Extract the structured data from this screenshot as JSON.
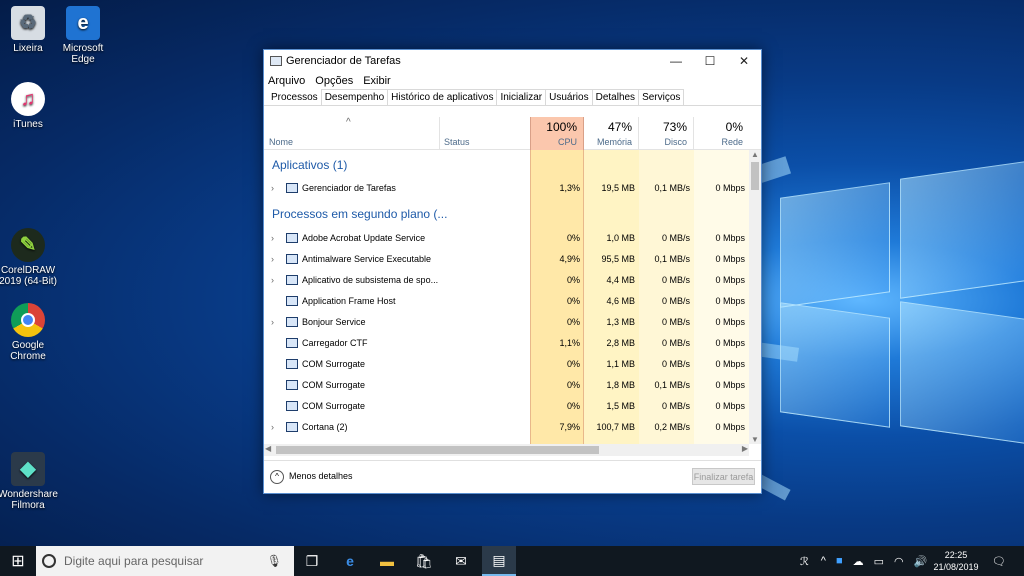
{
  "desktop": {
    "icons": [
      {
        "name": "recycle-bin",
        "label1": "Lixeira",
        "label2": ""
      },
      {
        "name": "edge",
        "label1": "Microsoft",
        "label2": "Edge"
      },
      {
        "name": "itunes",
        "label1": "iTunes",
        "label2": ""
      },
      {
        "name": "coreldraw",
        "label1": "CorelDRAW",
        "label2": "2019 (64-Bit)"
      },
      {
        "name": "chrome",
        "label1": "Google",
        "label2": "Chrome"
      },
      {
        "name": "filmora",
        "label1": "Wondershare",
        "label2": "Filmora"
      }
    ]
  },
  "window": {
    "title": "Gerenciador de Tarefas",
    "menu": [
      "Arquivo",
      "Opções",
      "Exibir"
    ],
    "tabs": [
      "Processos",
      "Desempenho",
      "Histórico de aplicativos",
      "Inicializar",
      "Usuários",
      "Detalhes",
      "Serviços"
    ],
    "columns": {
      "name": "Nome",
      "status": "Status",
      "cpu_pct": "100%",
      "cpu": "CPU",
      "mem_pct": "47%",
      "mem": "Memória",
      "disk_pct": "73%",
      "disk": "Disco",
      "net_pct": "0%",
      "net": "Rede"
    },
    "sections": {
      "apps": "Aplicativos (1)",
      "background": "Processos em segundo plano (..."
    },
    "processes": [
      {
        "name": "Gerenciador de Tarefas",
        "expand": true,
        "cpu": "1,3%",
        "mem": "19,5 MB",
        "disk": "0,1 MB/s",
        "net": "0 Mbps"
      },
      {
        "name": "Adobe Acrobat Update Service",
        "expand": true,
        "cpu": "0%",
        "mem": "1,0 MB",
        "disk": "0 MB/s",
        "net": "0 Mbps"
      },
      {
        "name": "Antimalware Service Executable",
        "expand": true,
        "cpu": "4,9%",
        "mem": "95,5 MB",
        "disk": "0,1 MB/s",
        "net": "0 Mbps"
      },
      {
        "name": "Aplicativo de subsistema de spo...",
        "expand": true,
        "cpu": "0%",
        "mem": "4,4 MB",
        "disk": "0 MB/s",
        "net": "0 Mbps"
      },
      {
        "name": "Application Frame Host",
        "expand": false,
        "cpu": "0%",
        "mem": "4,6 MB",
        "disk": "0 MB/s",
        "net": "0 Mbps"
      },
      {
        "name": "Bonjour Service",
        "expand": true,
        "cpu": "0%",
        "mem": "1,3 MB",
        "disk": "0 MB/s",
        "net": "0 Mbps"
      },
      {
        "name": "Carregador CTF",
        "expand": false,
        "cpu": "1,1%",
        "mem": "2,8 MB",
        "disk": "0 MB/s",
        "net": "0 Mbps"
      },
      {
        "name": "COM Surrogate",
        "expand": false,
        "cpu": "0%",
        "mem": "1,1 MB",
        "disk": "0 MB/s",
        "net": "0 Mbps"
      },
      {
        "name": "COM Surrogate",
        "expand": false,
        "cpu": "0%",
        "mem": "1,8 MB",
        "disk": "0,1 MB/s",
        "net": "0 Mbps"
      },
      {
        "name": "COM Surrogate",
        "expand": false,
        "cpu": "0%",
        "mem": "1,5 MB",
        "disk": "0 MB/s",
        "net": "0 Mbps"
      },
      {
        "name": "Cortana (2)",
        "expand": true,
        "cpu": "7,9%",
        "mem": "100,7 MB",
        "disk": "0,2 MB/s",
        "net": "0 Mbps"
      }
    ],
    "footer": {
      "less_details": "Menos detalhes",
      "end_task": "Finalizar tarefa"
    }
  },
  "taskbar": {
    "search_placeholder": "Digite aqui para pesquisar",
    "time": "22:25",
    "date": "21/08/2019"
  }
}
